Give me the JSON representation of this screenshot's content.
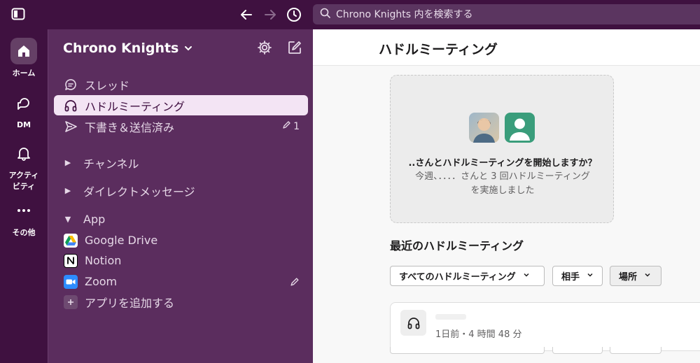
{
  "search": {
    "placeholder": "Chrono Knights 内を検索する"
  },
  "rail": {
    "items": [
      {
        "label": "ホーム",
        "icon": "home-icon"
      },
      {
        "label": "DM",
        "icon": "dm-icon"
      },
      {
        "label": "アクティビティ",
        "label_line1": "アクティ",
        "label_line2": "ビティ",
        "icon": "bell-icon"
      },
      {
        "label": "その他",
        "icon": "more-icon"
      }
    ]
  },
  "sidebar": {
    "workspace_name": "Chrono Knights",
    "nav": [
      {
        "label": "スレッド",
        "icon": "threads-icon"
      },
      {
        "label": "ハドルミーティング",
        "icon": "headphones-icon",
        "active": true
      },
      {
        "label": "下書き＆送信済み",
        "icon": "send-icon",
        "count": "1"
      }
    ],
    "sections": [
      {
        "label": "チャンネル"
      },
      {
        "label": "ダイレクトメッセージ"
      },
      {
        "label": "App"
      }
    ],
    "apps": [
      {
        "label": "Google Drive",
        "icon": "google-drive-icon"
      },
      {
        "label": "Notion",
        "icon": "notion-icon"
      },
      {
        "label": "Zoom",
        "icon": "zoom-icon"
      }
    ],
    "add_app_label": "アプリを追加する"
  },
  "main": {
    "title": "ハドルミーティング",
    "card": {
      "question": "..さんとハドルミーティングを開始しますか？",
      "subtitle_line1": "今週、．．．．さんと 3 回ハドルミーティング",
      "subtitle_line2": "を実施しました"
    },
    "recent_title": "最近のハドルミーティング",
    "filters": [
      "すべてのハドルミーティング",
      "相手",
      "場所"
    ],
    "recent_item": {
      "meta": "1日前・4 時間 48 分"
    }
  },
  "colors": {
    "aubergine": "#3f1140",
    "sidebar": "#5b2d5e",
    "active_row": "#f3e4f4",
    "zoom_blue": "#2d8cff"
  }
}
